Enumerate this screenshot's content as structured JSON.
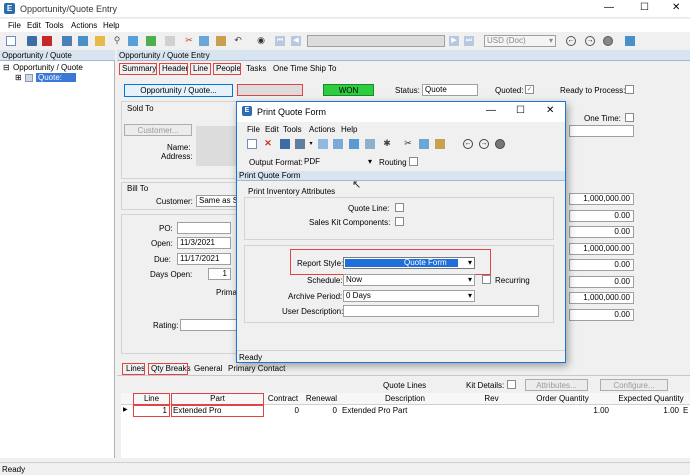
{
  "window": {
    "title": "Opportunity/Quote Entry",
    "min": "—",
    "max": "☐",
    "close": "✕"
  },
  "menu": {
    "file": "File",
    "edit": "Edit",
    "tools": "Tools",
    "actions": "Actions",
    "help": "Help"
  },
  "toolbar": {
    "nav_value": "",
    "currency": "USD (Doc)"
  },
  "tree": {
    "header": "Opportunity / Quote",
    "root": "Opportunity / Quote",
    "child": "Quote:"
  },
  "panel": {
    "header": "Opportunity / Quote Entry"
  },
  "tabs": {
    "summary": "Summary",
    "header": "Header",
    "line": "Line",
    "people": "People",
    "tasks": "Tasks",
    "onetime": "One Time Ship To"
  },
  "summary": {
    "opp_quote_btn": "Opportunity / Quote...",
    "won": "WON",
    "status_label": "Status:",
    "status_value": "Quote",
    "quoted_label": "Quoted:",
    "ready_label": "Ready to Process:",
    "sold_to": "Sold To",
    "customer_btn": "Customer...",
    "name_label": "Name:",
    "address_label": "Address:",
    "one_time_label": "One Time:",
    "bill_to": "Bill To",
    "customer_label": "Customer:",
    "customer_value": "Same as So",
    "po_label": "PO:",
    "open_label": "Open:",
    "open_value": "11/3/2021",
    "due_label": "Due:",
    "due_value": "11/17/2021",
    "days_open_label": "Days Open:",
    "days_open_value": "1",
    "primary_label": "Primar",
    "rating_label": "Rating:"
  },
  "totals": [
    "1,000,000.00",
    "0.00",
    "0.00",
    "1,000,000.00",
    "0.00",
    "0.00",
    "1,000,000.00",
    "0.00"
  ],
  "bottom_tabs": {
    "lines": "Lines",
    "qty_breaks": "Qty Breaks",
    "general": "General",
    "primary_contact": "Primary Contact"
  },
  "lines_bar": {
    "quote_lines": "Quote Lines",
    "kit_details": "Kit Details:",
    "attributes_btn": "Attributes...",
    "configure_btn": "Configure..."
  },
  "grid": {
    "headers": {
      "line": "Line",
      "part": "Part",
      "contract": "Contract",
      "renewal": "Renewal",
      "description": "Description",
      "rev": "Rev",
      "order_qty": "Order Quantity",
      "expected_qty": "Expected Quantity"
    },
    "row": {
      "line": "1",
      "part": "Extended Pro",
      "contract": "0",
      "renewal": "0",
      "description": "Extended Pro Part",
      "rev": "",
      "order_qty": "1.00",
      "expected_qty": "1.00",
      "extra": "E"
    }
  },
  "status_bar": {
    "text": "Ready"
  },
  "dialog": {
    "title": "Print Quote Form",
    "menu": {
      "file": "File",
      "edit": "Edit",
      "tools": "Tools",
      "actions": "Actions",
      "help": "Help"
    },
    "output_format_label": "Output Format:",
    "output_format_value": "PDF",
    "routing_label": "Routing",
    "header": "Print Quote Form",
    "attributes_title": "Print Inventory Attributes",
    "quote_line_label": "Quote Line:",
    "sales_kit_label": "Sales Kit Components:",
    "report_style_label": "Report Style:",
    "report_style_value": "Quote Form",
    "schedule_label": "Schedule:",
    "schedule_value": "Now",
    "recurring_label": "Recurring",
    "archive_label": "Archive Period:",
    "archive_value": "0 Days",
    "user_desc_label": "User Description:",
    "status": "Ready"
  }
}
